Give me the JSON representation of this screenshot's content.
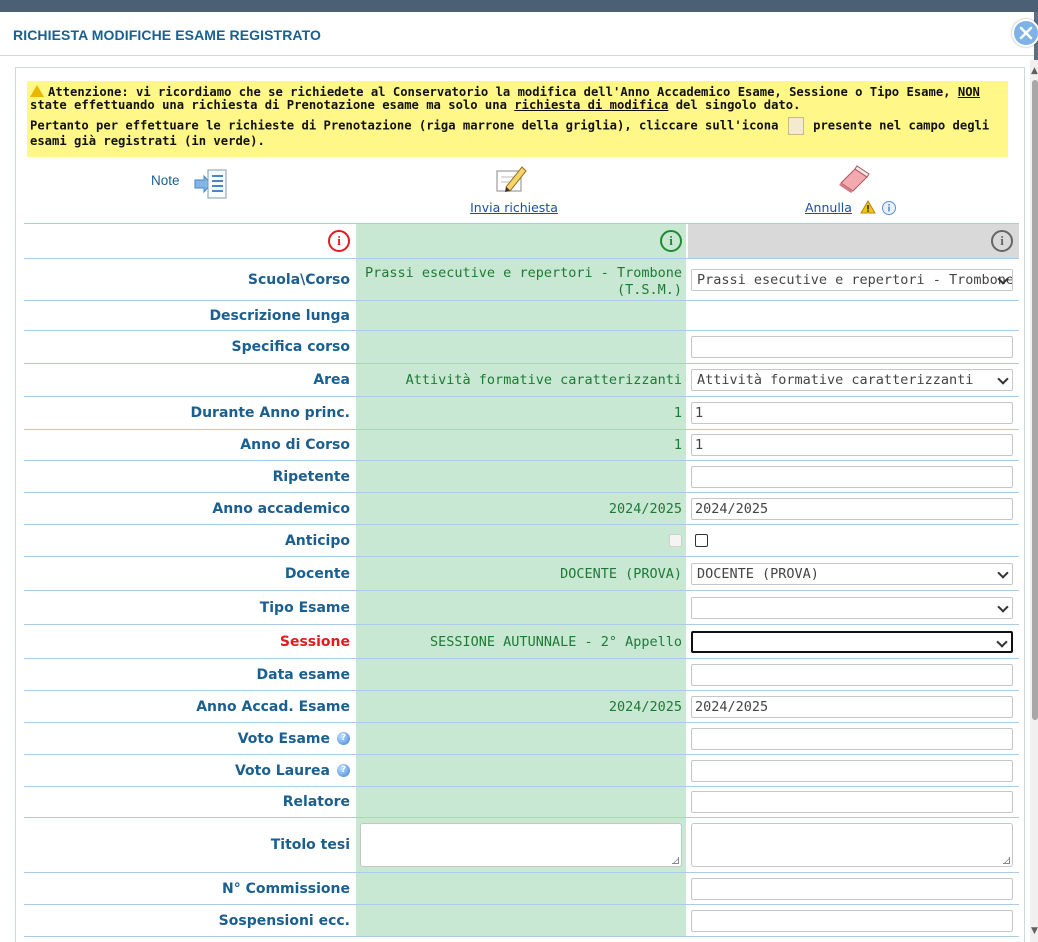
{
  "dialog": {
    "title": "RICHIESTA MODIFICHE ESAME REGISTRATO"
  },
  "warning": {
    "p1_a": "Attenzione: vi ricordiamo che se richiedete al Conservatorio la modifica dell'Anno Accademico Esame, Sessione o Tipo Esame, ",
    "p1_non": "NON",
    "p1_b": " state effettuando una richiesta di Prenotazione esame ma solo una ",
    "p1_link": "richiesta di modifica",
    "p1_c": " del singolo dato.",
    "p2_a": "Pertanto per effettuare le richieste di Prenotazione (riga marrone della griglia), cliccare sull'icona ",
    "p2_b": " presente nel campo degli esami già registrati (in verde)."
  },
  "toolbar": {
    "note_label": "Note",
    "invia_label": "Invia richiesta",
    "annulla_label": "Annulla"
  },
  "colors": {
    "header_left_icon": "#e01c1c",
    "header_mid_icon": "#1e8a2e",
    "header_right_icon": "#666666",
    "current_bg": "#c8e8d4",
    "label_color": "#1a5f8f"
  },
  "rows": [
    {
      "label": "Scuola\\Corso",
      "current": "Prassi esecutive e repertori - Trombone (T.S.M.)",
      "new": "Prassi esecutive e repertori - Trombone (T.S.M.)"
    },
    {
      "label": "Descrizione lunga",
      "current": "",
      "new": ""
    },
    {
      "label": "Specifica corso",
      "current": "",
      "new": ""
    },
    {
      "label": "Area",
      "current": "Attività formative caratterizzanti",
      "new": "Attività formative caratterizzanti"
    },
    {
      "label": "Durante Anno princ.",
      "current": "1",
      "new": "1"
    },
    {
      "label": "Anno di Corso",
      "current": "1",
      "new": "1"
    },
    {
      "label": "Ripetente",
      "current": "",
      "new": ""
    },
    {
      "label": "Anno accademico",
      "current": "2024/2025",
      "new": "2024/2025"
    },
    {
      "label": "Anticipo",
      "current": "",
      "new": ""
    },
    {
      "label": "Docente",
      "current": "DOCENTE (PROVA)",
      "new": "DOCENTE (PROVA)"
    },
    {
      "label": "Tipo Esame",
      "current": "",
      "new": ""
    },
    {
      "label": "Sessione",
      "current": "SESSIONE AUTUNNALE - 2° Appello",
      "new": ""
    },
    {
      "label": "Data esame",
      "current": "",
      "new": ""
    },
    {
      "label": "Anno Accad. Esame",
      "current": "2024/2025",
      "new": "2024/2025"
    },
    {
      "label": "Voto Esame",
      "current": "",
      "new": ""
    },
    {
      "label": "Voto Laurea",
      "current": "",
      "new": ""
    },
    {
      "label": "Relatore",
      "current": "",
      "new": ""
    },
    {
      "label": "Titolo tesi",
      "current": "",
      "new": ""
    },
    {
      "label": "N° Commissione",
      "current": "",
      "new": ""
    },
    {
      "label": "Sospensioni ecc.",
      "current": "",
      "new": ""
    }
  ]
}
